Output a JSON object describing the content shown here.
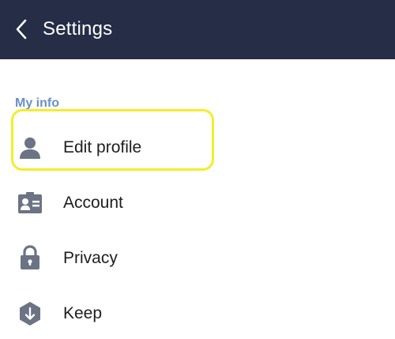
{
  "header": {
    "title": "Settings"
  },
  "sections": [
    {
      "label": "My info",
      "items": [
        {
          "label": "Edit profile",
          "icon": "person-icon"
        },
        {
          "label": "Account",
          "icon": "id-card-icon"
        },
        {
          "label": "Privacy",
          "icon": "lock-icon"
        },
        {
          "label": "Keep",
          "icon": "keep-icon"
        }
      ]
    }
  ],
  "colors": {
    "header_bg": "#252d47",
    "section_label": "#6a8fc7",
    "icon": "#6b7384",
    "highlight": "#f2ee2a"
  }
}
